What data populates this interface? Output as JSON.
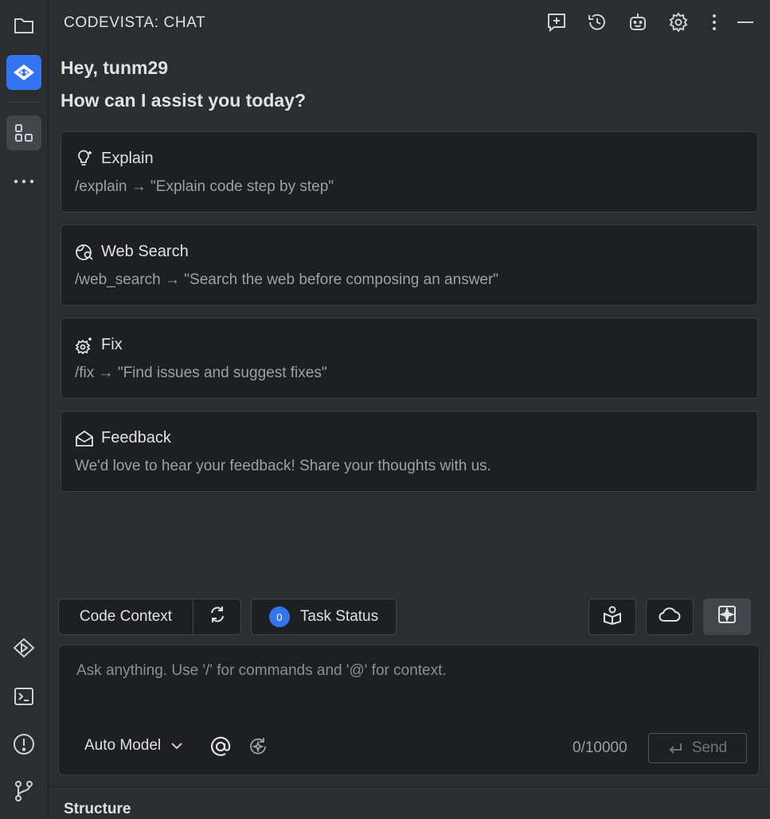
{
  "app": {
    "title": "CODEVISTA: CHAT"
  },
  "sidebar": {
    "icons": [
      "folder-icon",
      "codevista-icon",
      "structure-icon",
      "more-icon",
      "run-icon",
      "terminal-icon",
      "problems-icon",
      "git-icon"
    ]
  },
  "header": {
    "actions": [
      "new-chat-icon",
      "history-icon",
      "agent-icon",
      "settings-icon",
      "more-vert-icon",
      "minimize-icon"
    ]
  },
  "greeting": {
    "line1": "Hey, tunm29",
    "line2": "How can I assist you today?"
  },
  "cards": [
    {
      "icon": "lightbulb-icon",
      "title": "Explain",
      "desc": "/explain → \"Explain code step by step\""
    },
    {
      "icon": "web-search-icon",
      "title": "Web Search",
      "desc": "/web_search → \"Search the web before composing an answer\""
    },
    {
      "icon": "fix-gear-icon",
      "title": "Fix",
      "desc": "/fix → \"Find issues and suggest fixes\""
    },
    {
      "icon": "mail-open-icon",
      "title": "Feedback",
      "desc": "We'd love to hear your feedback! Share your thoughts with us."
    }
  ],
  "toolbar": {
    "code_context": "Code Context",
    "task_badge": "0",
    "task_status": "Task Status"
  },
  "input": {
    "placeholder": "Ask anything. Use '/' for commands and '@' for context.",
    "model": "Auto Model",
    "counter": "0/10000",
    "send": "Send"
  },
  "bottom": {
    "structure": "Structure"
  },
  "colors": {
    "accent": "#3574f0",
    "background": "#2b2d30",
    "card": "#1e1f22"
  }
}
